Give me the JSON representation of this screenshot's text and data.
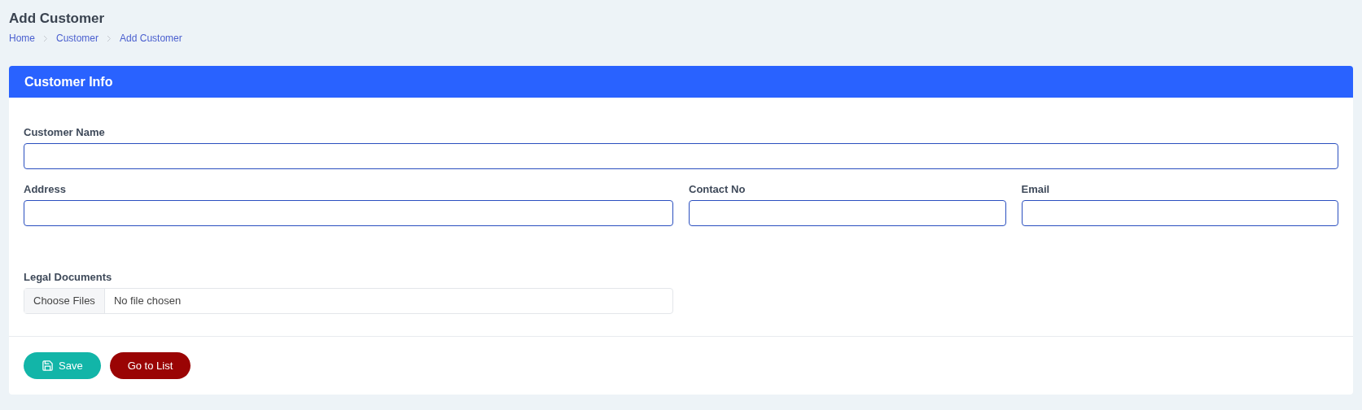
{
  "page_title": "Add Customer",
  "breadcrumb": [
    "Home",
    "Customer",
    "Add Customer"
  ],
  "card": {
    "title": "Customer Info",
    "rows": [
      [
        {
          "label": "Customer Name",
          "kind": "text"
        }
      ],
      [
        {
          "label": "Address",
          "kind": "text"
        },
        {
          "label": "Contact No",
          "kind": "text"
        },
        {
          "label": "Email",
          "kind": "text"
        }
      ],
      [
        {
          "label": "Legal Documents",
          "kind": "file",
          "button": "Choose Files",
          "value": "No file chosen"
        }
      ]
    ],
    "buttons": [
      {
        "label": "Save",
        "kind": "save"
      },
      {
        "label": "Go to List",
        "kind": "list"
      }
    ]
  }
}
